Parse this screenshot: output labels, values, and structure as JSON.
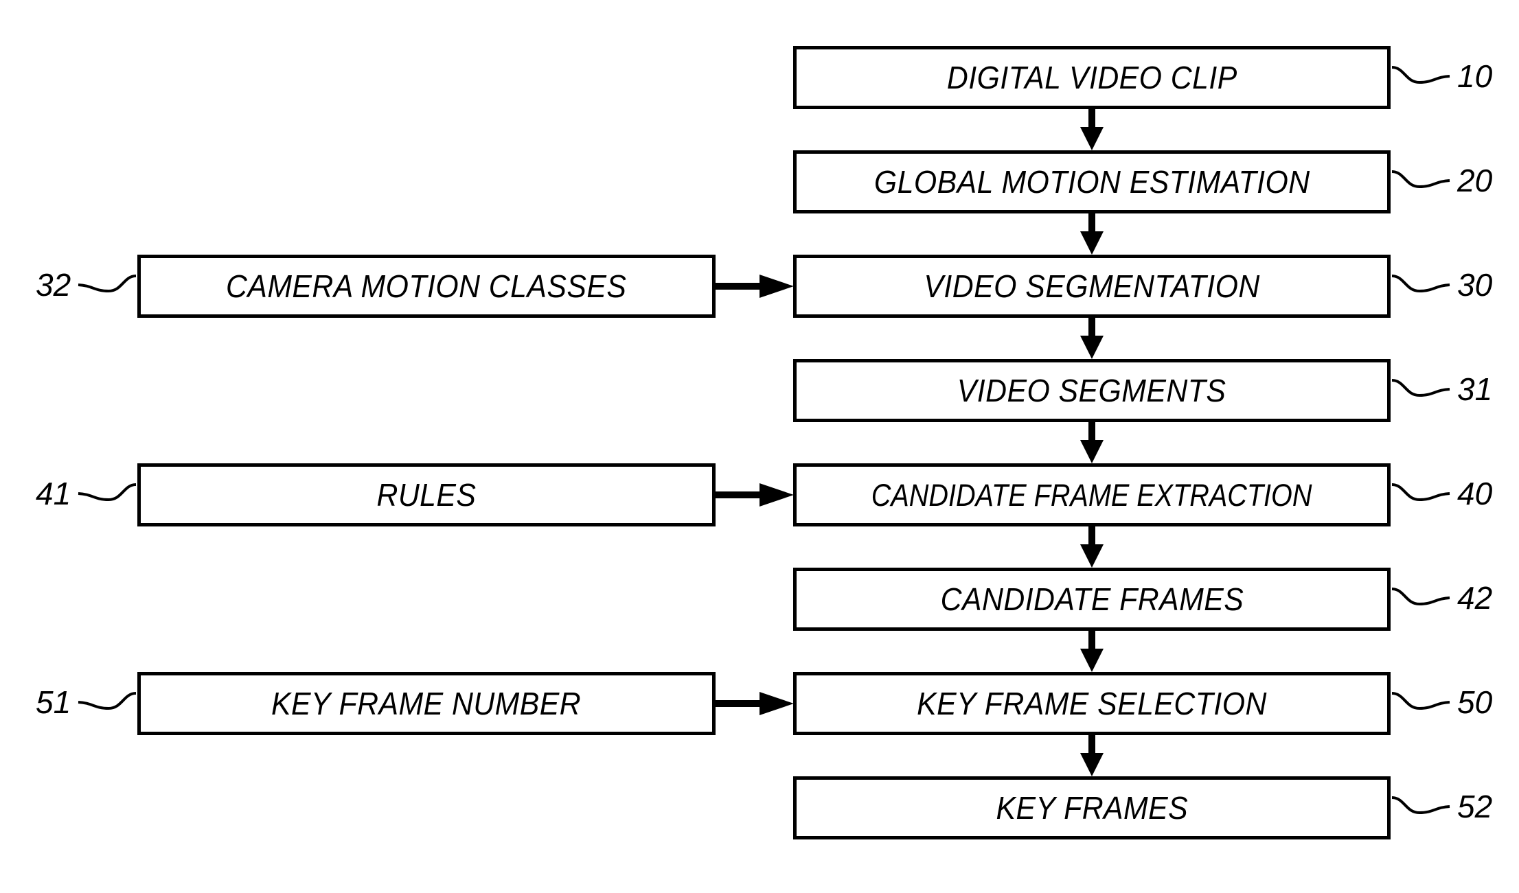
{
  "figure": {
    "type": "patent-flowchart",
    "orientation": "vertical-pipeline-with-side-inputs",
    "background_color": "#ffffff",
    "line_color": "#000000"
  },
  "main_flow": {
    "column": "right",
    "steps": [
      {
        "id": "step-10",
        "label": "DIGITAL VIDEO CLIP",
        "ref": "10"
      },
      {
        "id": "step-20",
        "label": "GLOBAL MOTION ESTIMATION",
        "ref": "20"
      },
      {
        "id": "step-30",
        "label": "VIDEO SEGMENTATION",
        "ref": "30"
      },
      {
        "id": "step-31",
        "label": "VIDEO SEGMENTS",
        "ref": "31"
      },
      {
        "id": "step-40",
        "label": "CANDIDATE FRAME EXTRACTION",
        "ref": "40"
      },
      {
        "id": "step-42",
        "label": "CANDIDATE FRAMES",
        "ref": "42"
      },
      {
        "id": "step-50",
        "label": "KEY FRAME SELECTION",
        "ref": "50"
      },
      {
        "id": "step-52",
        "label": "KEY FRAMES",
        "ref": "52"
      }
    ]
  },
  "side_inputs": {
    "column": "left",
    "items": [
      {
        "id": "input-32",
        "label": "CAMERA MOTION CLASSES",
        "ref": "32",
        "feeds": "step-30"
      },
      {
        "id": "input-41",
        "label": "RULES",
        "ref": "41",
        "feeds": "step-40"
      },
      {
        "id": "input-51",
        "label": "KEY FRAME NUMBER",
        "ref": "51",
        "feeds": "step-50"
      }
    ]
  },
  "connections": {
    "vertical_arrows": [
      {
        "from": "step-10",
        "to": "step-20"
      },
      {
        "from": "step-20",
        "to": "step-30"
      },
      {
        "from": "step-30",
        "to": "step-31"
      },
      {
        "from": "step-31",
        "to": "step-40"
      },
      {
        "from": "step-40",
        "to": "step-42"
      },
      {
        "from": "step-42",
        "to": "step-50"
      },
      {
        "from": "step-50",
        "to": "step-52"
      }
    ],
    "horizontal_arrows": [
      {
        "from": "input-32",
        "to": "step-30"
      },
      {
        "from": "input-41",
        "to": "step-40"
      },
      {
        "from": "input-51",
        "to": "step-50"
      }
    ]
  }
}
